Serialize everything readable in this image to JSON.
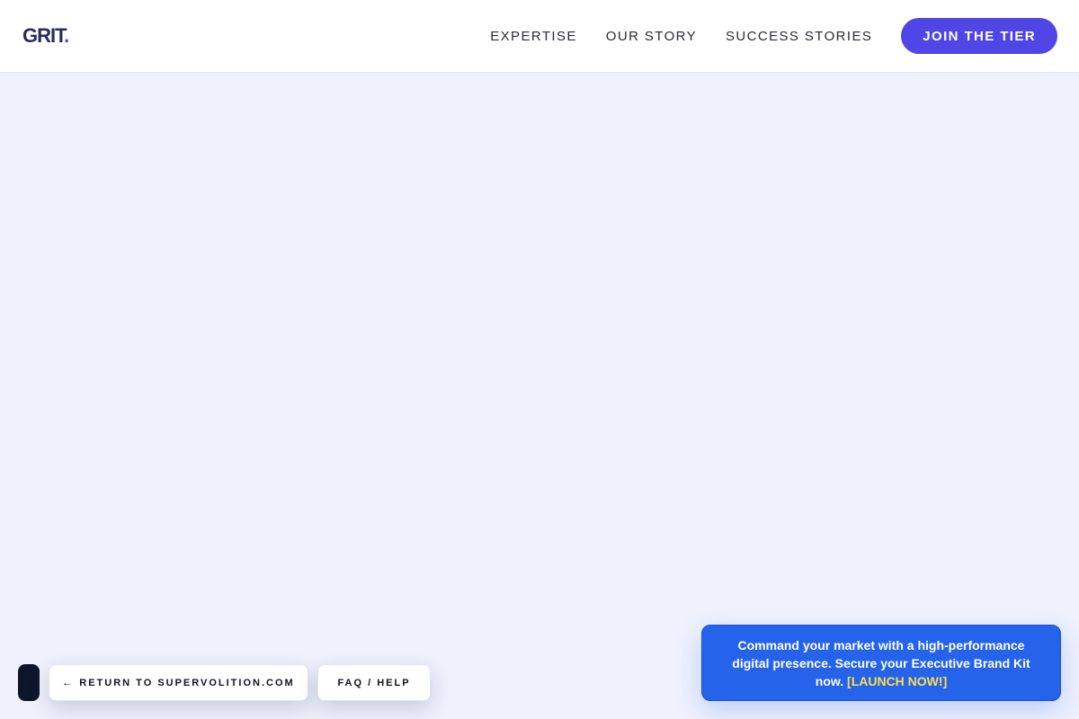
{
  "header": {
    "logo_text": "GRIT",
    "logo_dot": ".",
    "nav": [
      {
        "label": "EXPERTISE"
      },
      {
        "label": "OUR STORY"
      },
      {
        "label": "SUCCESS STORIES"
      }
    ],
    "cta_label": "JOIN THE TIER"
  },
  "bottom_controls": {
    "return_arrow": "←",
    "return_label": "RETURN TO SUPERVOLITION.COM",
    "faq_label": "FAQ / HELP"
  },
  "promo": {
    "text": "Command your market with a high-performance digital presence. Secure your Executive Brand Kit now.",
    "link_label": "[LAUNCH NOW!]"
  },
  "colors": {
    "accent": "#4f46e5",
    "background": "#eff2fd",
    "promo_bg": "#2563eb",
    "promo_link": "#fde047",
    "dark_pill": "#10162a"
  }
}
